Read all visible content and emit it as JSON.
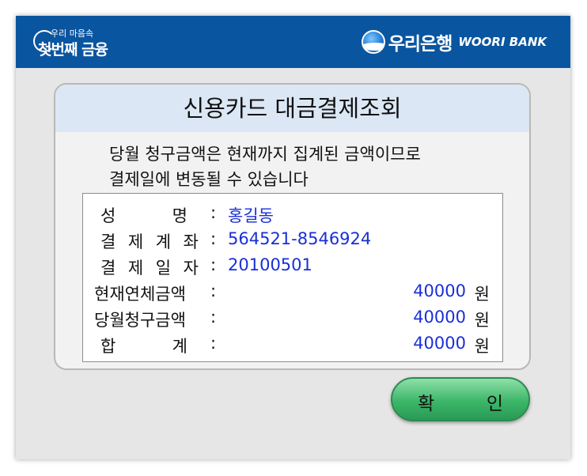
{
  "header": {
    "left_logo_small": "우리 마음속",
    "left_logo_big": "첫번째 금융",
    "bank_name_ko": "우리은행",
    "bank_name_en": "WOORI BANK"
  },
  "panel": {
    "title": "신용카드 대금결제조회",
    "notice_line1": "당월 청구금액은 현재까지 집계된 금액이므로",
    "notice_line2": "결제일에 변동될 수 있습니다"
  },
  "info": {
    "name": {
      "label_chars": [
        "성",
        "명"
      ],
      "value": "홍길동"
    },
    "account": {
      "label_chars": [
        "결",
        "제",
        "계",
        "좌"
      ],
      "value": "564521-8546924"
    },
    "pay_date": {
      "label_chars": [
        "결",
        "제",
        "일",
        "자"
      ],
      "value": "20100501"
    },
    "current_overdue": {
      "label": "현재연체금액",
      "amount": "40000",
      "unit": "원"
    },
    "monthly_bill": {
      "label": "당월청구금액",
      "amount": "40000",
      "unit": "원"
    },
    "total": {
      "label_chars": [
        "합",
        "계"
      ],
      "amount": "40000",
      "unit": "원"
    },
    "colon": ":"
  },
  "confirm_button": {
    "char1": "확",
    "char2": "인"
  },
  "colors": {
    "header_bg": "#0a55a0",
    "value_blue": "#1a2fd6",
    "button_green": "#3cb669",
    "title_bg": "#dce7f5"
  }
}
